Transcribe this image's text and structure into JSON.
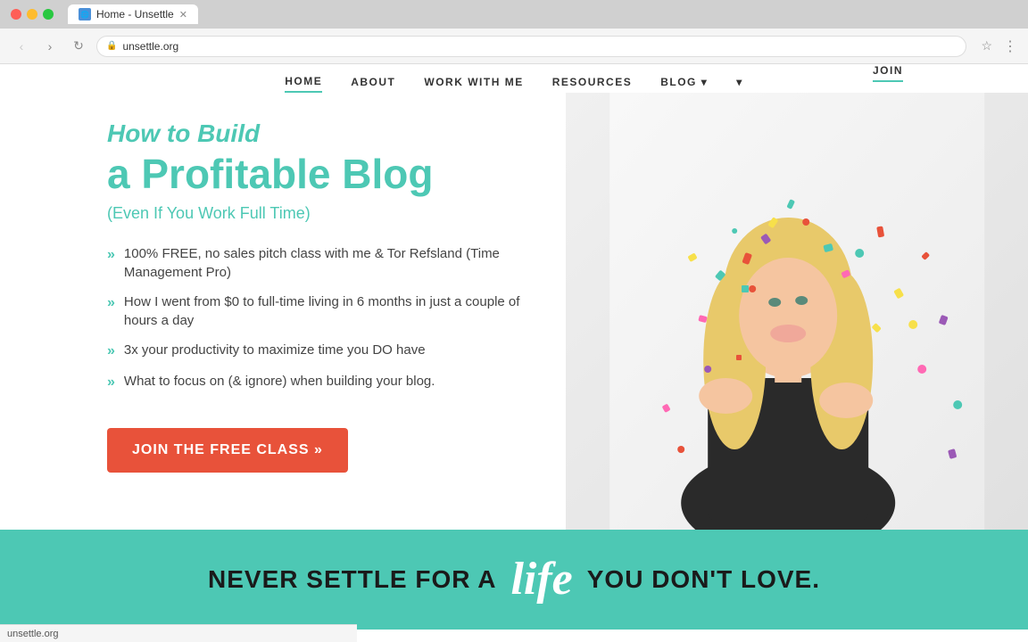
{
  "browser": {
    "tab_title": "Home - Unsettle",
    "url": "unsettle.org",
    "favicon_label": "U"
  },
  "nav": {
    "items": [
      {
        "label": "HOME",
        "active": true
      },
      {
        "label": "ABOUT",
        "active": false
      },
      {
        "label": "WORK WITH ME",
        "active": false
      },
      {
        "label": "RESOURCES",
        "active": false
      },
      {
        "label": "BLOG ▾",
        "active": false
      },
      {
        "label": "▾",
        "active": false
      }
    ],
    "join_label": "JOIN"
  },
  "hero": {
    "title_small": "How to Build",
    "title_large": "a Profitable Blog",
    "subtitle": "(Even If You Work Full Time)",
    "bullets": [
      "100% FREE, no sales pitch class with me & Tor Refsland (Time Management Pro)",
      "How I went from $0 to full-time living in 6 months in just a couple of hours a day",
      "3x your productivity to maximize time you DO have",
      "What to focus on (& ignore) when building your blog."
    ],
    "cta_label": "JOIN THE FREE CLASS »"
  },
  "footer": {
    "text1": "NEVER SETTLE FOR A",
    "text_script": "life",
    "text2": "YOU DON'T LOVE."
  },
  "status": {
    "url": "unsettle.org"
  },
  "colors": {
    "teal": "#4dc8b4",
    "red": "#e8523a",
    "dark": "#1a1a1a"
  }
}
